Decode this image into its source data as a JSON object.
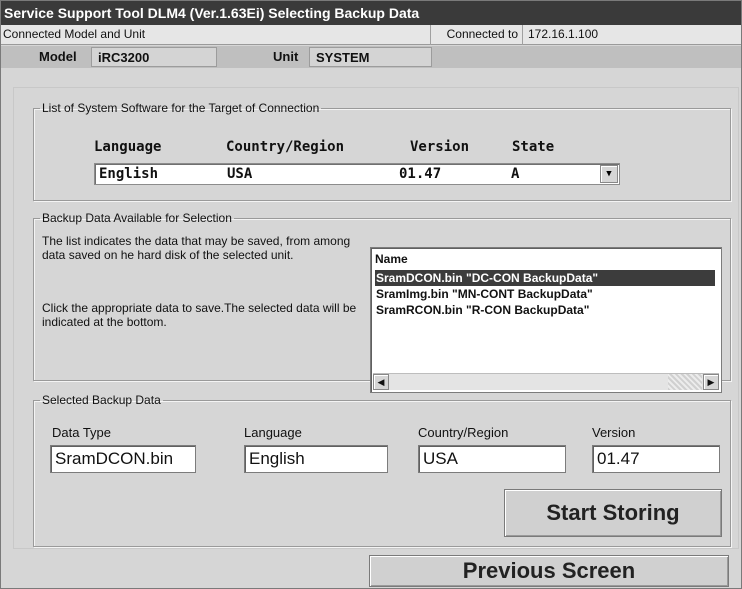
{
  "window": {
    "title": "Service Support Tool DLM4 (Ver.1.63Ei) Selecting Backup Data"
  },
  "connection": {
    "section_label": "Connected Model and Unit",
    "connected_to_label": "Connected to",
    "ip_address": "172.16.1.100",
    "model_label": "Model",
    "model_value": "iRC3200",
    "unit_label": "Unit",
    "unit_value": "SYSTEM"
  },
  "system_software": {
    "legend": "List of System Software for the Target of Connection",
    "headers": {
      "language": "Language",
      "country": "Country/Region",
      "version": "Version",
      "state": "State"
    },
    "row": {
      "language": "English",
      "country": "USA",
      "version": "01.47",
      "state": "A"
    },
    "dropdown_icon": "triangle-down"
  },
  "backup_selection": {
    "legend": "Backup Data Available for Selection",
    "description_1": "The list indicates the data that may be saved, from among data saved on he hard disk of the selected unit.",
    "description_2": "Click the appropriate data to save.The selected data will be indicated at the bottom.",
    "list_header": "Name",
    "items": [
      "SramDCON.bin \"DC-CON BackupData\"",
      "SramImg.bin \"MN-CONT BackupData\"",
      "SramRCON.bin \"R-CON BackupData\""
    ],
    "selected_index": 0
  },
  "selected_backup": {
    "legend": "Selected Backup Data",
    "data_type_label": "Data Type",
    "data_type_value": "SramDCON.bin",
    "language_label": "Language",
    "language_value": "English",
    "country_label": "Country/Region",
    "country_value": "USA",
    "version_label": "Version",
    "version_value": "01.47"
  },
  "actions": {
    "start_storing": "Start Storing",
    "previous_screen": "Previous Screen"
  },
  "colors": {
    "titlebar": "#3a3a3a",
    "selection": "#3c3c3c",
    "window_bg": "#d6d6d6"
  }
}
